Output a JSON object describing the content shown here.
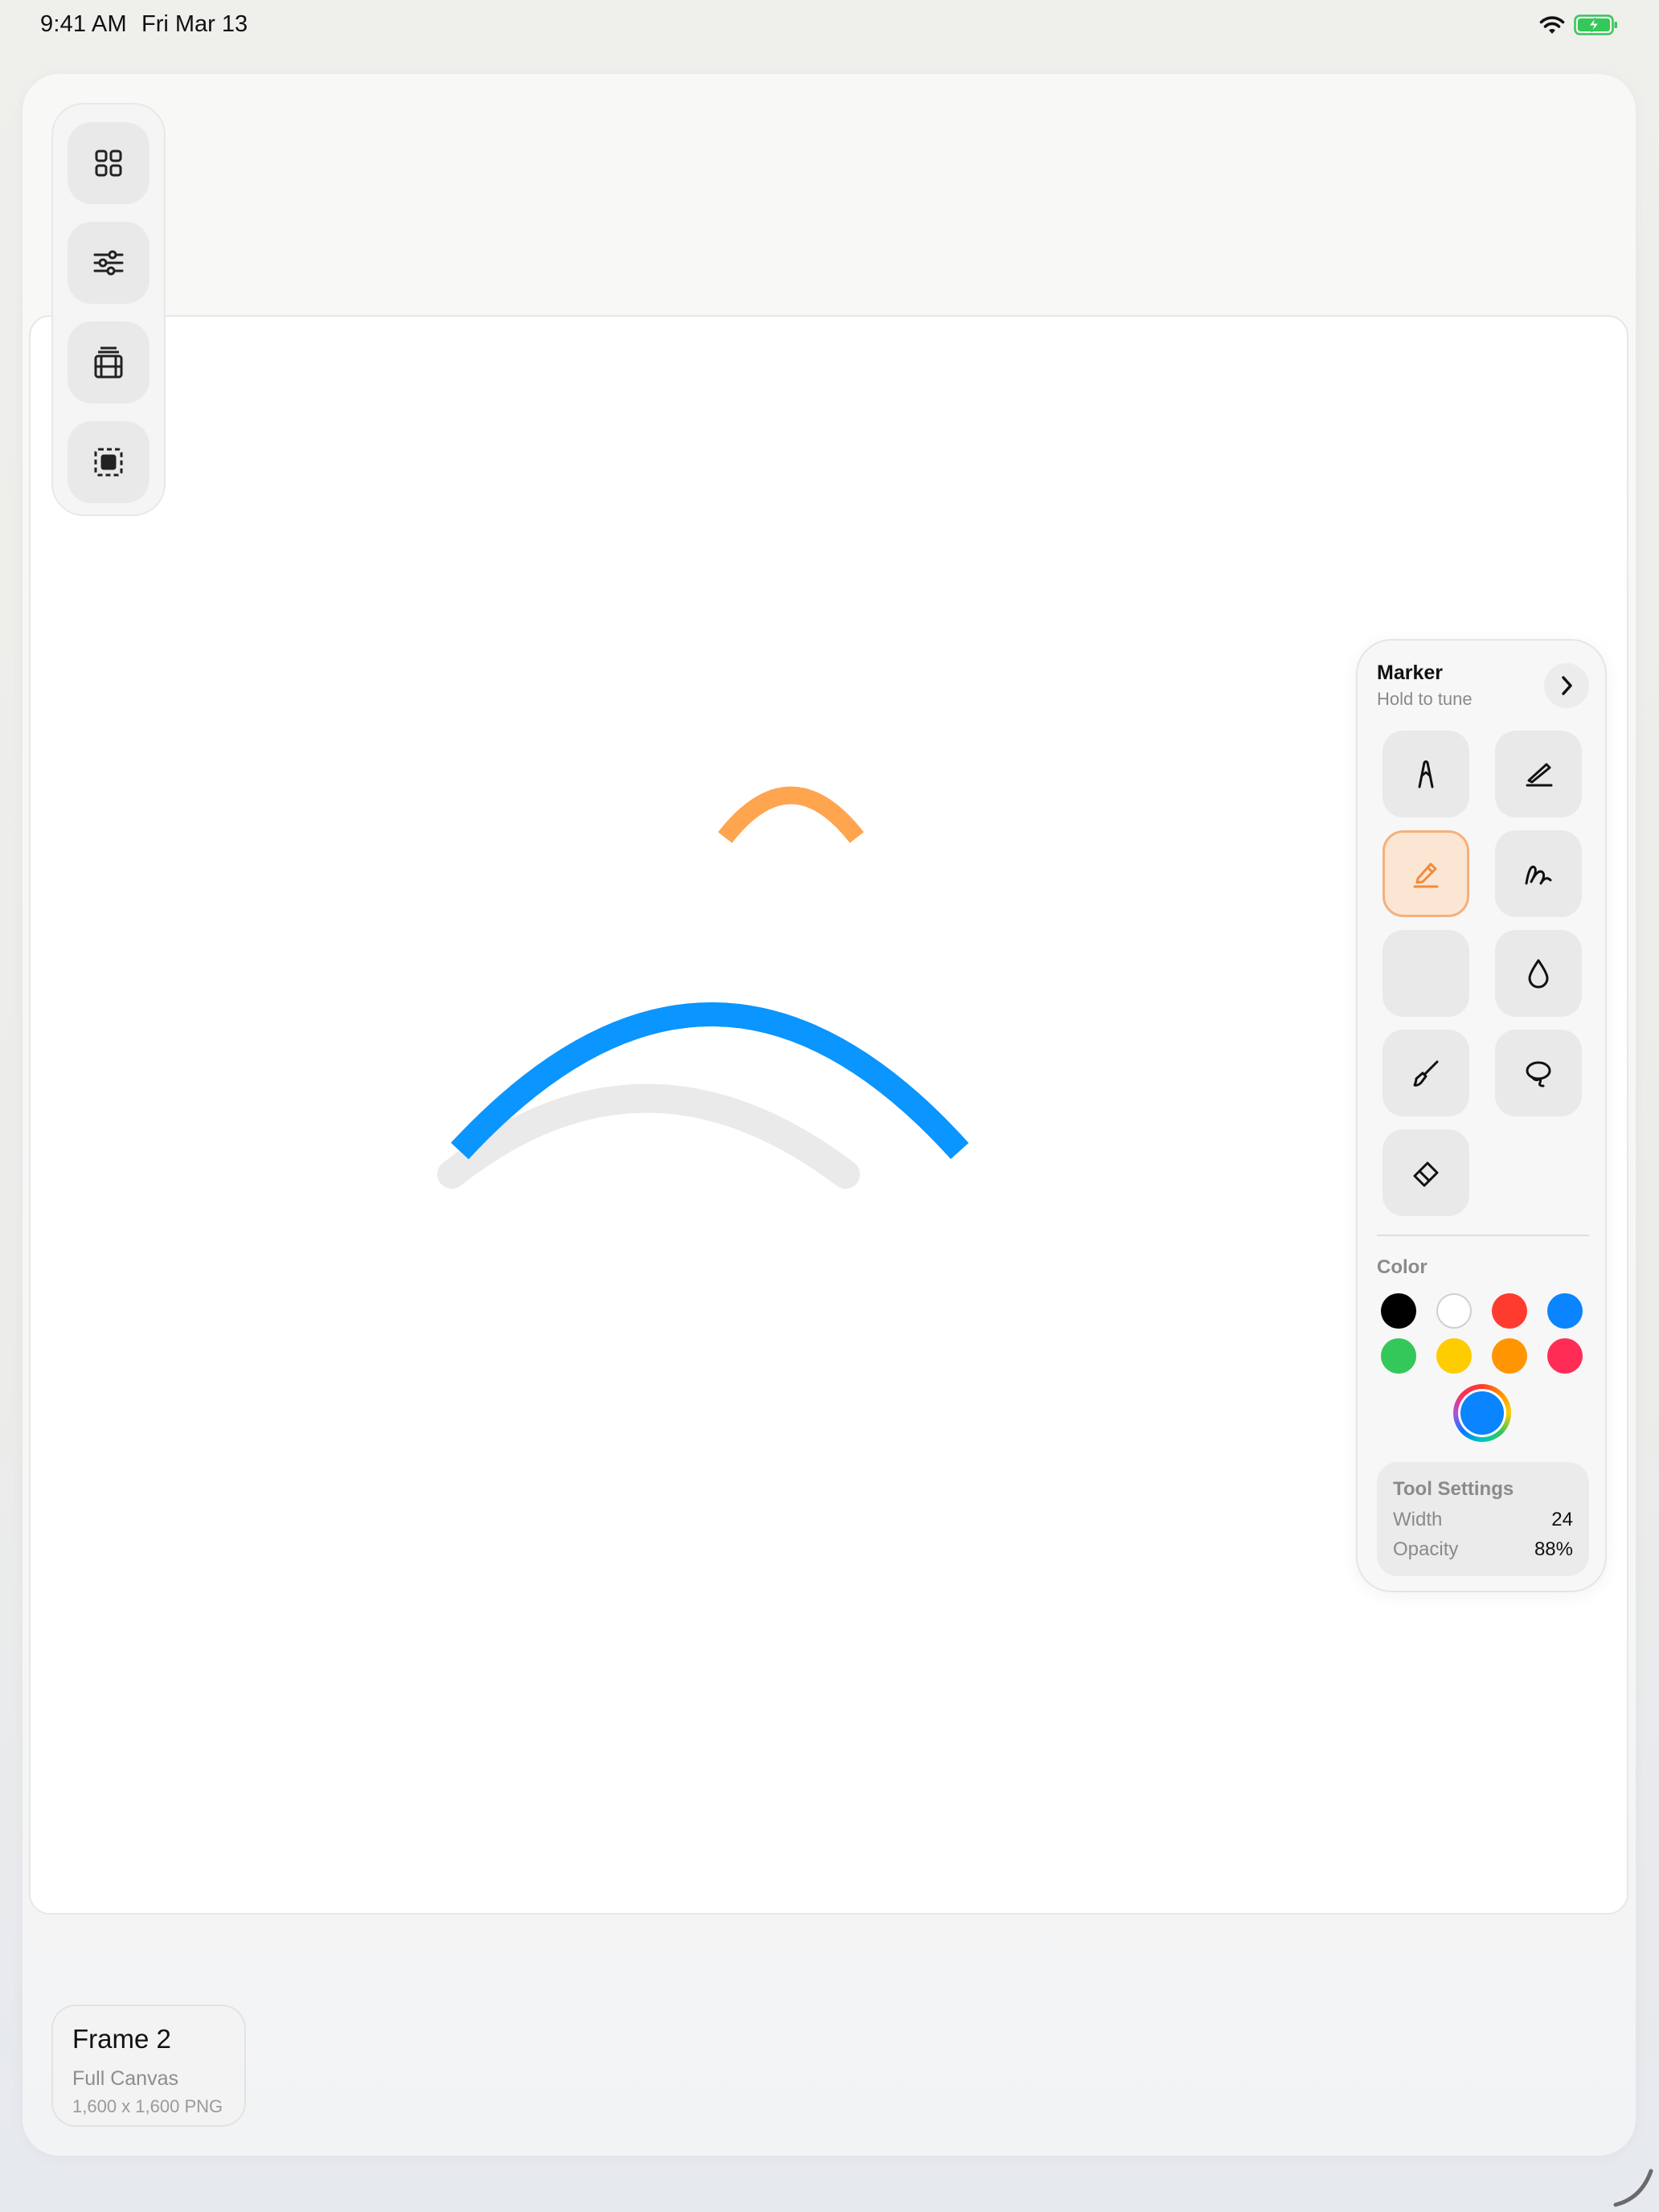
{
  "status_bar": {
    "time": "9:41 AM",
    "date": "Fri Mar 13",
    "icons": [
      "wifi-icon",
      "battery-charging-icon"
    ]
  },
  "left_toolbar": {
    "buttons": [
      {
        "icon": "grid-icon"
      },
      {
        "icon": "sliders-icon"
      },
      {
        "icon": "film-stack-icon"
      },
      {
        "icon": "selection-icon"
      }
    ]
  },
  "tool_panel": {
    "title": "Marker",
    "subtitle": "Hold to tune",
    "tools": [
      {
        "icon": "pen-nib-icon",
        "active": false
      },
      {
        "icon": "pencil-slant-icon",
        "active": false
      },
      {
        "icon": "marker-icon",
        "active": true
      },
      {
        "icon": "scribble-icon",
        "active": false
      },
      {
        "icon": "empty-slot",
        "active": false
      },
      {
        "icon": "droplet-icon",
        "active": false
      },
      {
        "icon": "brush-icon",
        "active": false
      },
      {
        "icon": "lasso-icon",
        "active": false
      },
      {
        "icon": "eraser-icon",
        "active": false
      }
    ],
    "color_label": "Color",
    "swatches": [
      "#000000",
      "#ffffff",
      "#ff3b30",
      "#0a84ff",
      "#34c759",
      "#ffcc00",
      "#ff9500",
      "#ff2d55"
    ],
    "current_color": "#0a84ff",
    "settings": {
      "title": "Tool Settings",
      "width_label": "Width",
      "width_value": "24",
      "opacity_label": "Opacity",
      "opacity_value": "88%"
    }
  },
  "frame_card": {
    "title": "Frame 2",
    "subtitle": "Full Canvas",
    "dimensions": "1,600 x 1,600 PNG"
  },
  "stroke_colors": {
    "orange": "#ff9a3c",
    "blue": "#0a95ff",
    "gray": "#d9d9d9"
  }
}
